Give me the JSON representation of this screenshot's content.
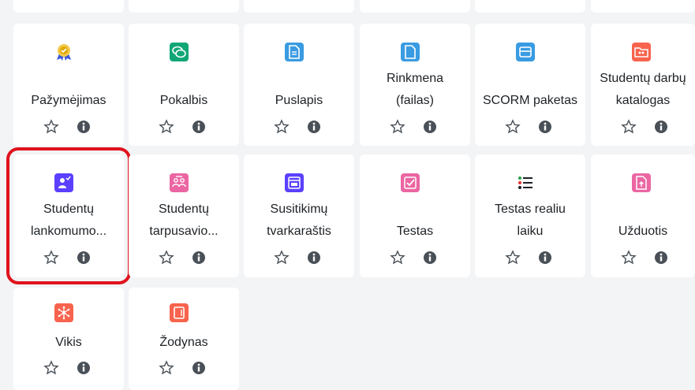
{
  "tiles": [
    {
      "name": "Pažymėjimas",
      "icon": "certificate-icon"
    },
    {
      "name": "Pokalbis",
      "icon": "chat-icon",
      "color": "#11a676"
    },
    {
      "name": "Puslapis",
      "icon": "page-icon",
      "color": "#399be2"
    },
    {
      "name": "Rinkmena (failas)",
      "line1": "Rinkmena",
      "line2": "(failas)",
      "icon": "file-icon",
      "color": "#399be2"
    },
    {
      "name": "SCORM paketas",
      "icon": "scorm-icon",
      "color": "#399be2"
    },
    {
      "name": "Studentų darbų katalogas",
      "line1": "Studentų darbų",
      "line2": "katalogas",
      "icon": "folder-icon",
      "color": "#f7634d"
    },
    {
      "name": "Studentų lankomumo...",
      "line1": "Studentų",
      "line2": "lankomumo...",
      "icon": "attendance-icon",
      "color": "#5b40ff"
    },
    {
      "name": "Studentų tarpusavio...",
      "line1": "Studentų",
      "line2": "tarpusavio...",
      "icon": "workshop-icon",
      "color": "#eb66a2"
    },
    {
      "name": "Susitikimų tvarkaraštis",
      "line1": "Susitikimų",
      "line2": "tvarkaraštis",
      "icon": "scheduler-icon",
      "color": "#5b40ff"
    },
    {
      "name": "Testas",
      "icon": "quiz-icon",
      "color": "#eb66a2"
    },
    {
      "name": "Testas realiu laiku",
      "line1": "Testas realiu",
      "line2": "laiku",
      "icon": "realtime-quiz-icon"
    },
    {
      "name": "Užduotis",
      "icon": "assignment-icon",
      "color": "#eb66a2"
    },
    {
      "name": "Vikis",
      "icon": "wiki-icon",
      "color": "#f7634d"
    },
    {
      "name": "Žodynas",
      "icon": "glossary-icon",
      "color": "#f7634d"
    }
  ],
  "colors": {
    "selected_outline": "#e0131d",
    "star": "#495057",
    "info": "#495057"
  }
}
